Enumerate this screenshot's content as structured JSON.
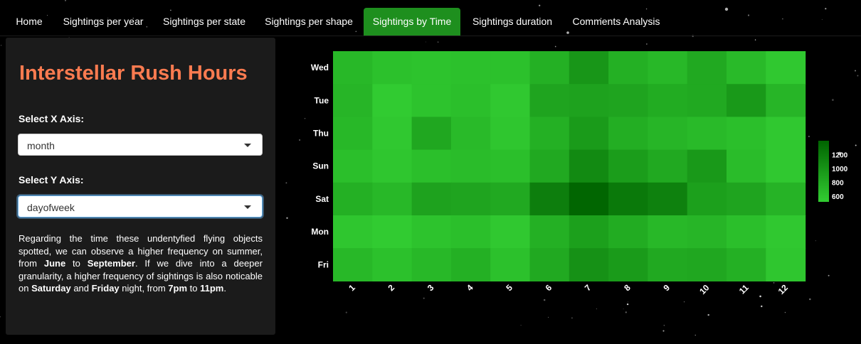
{
  "nav": {
    "items": [
      {
        "label": "Home",
        "active": false
      },
      {
        "label": "Sightings per year",
        "active": false
      },
      {
        "label": "Sightings per state",
        "active": false
      },
      {
        "label": "Sightings per shape",
        "active": false
      },
      {
        "label": "Sightings by Time",
        "active": true
      },
      {
        "label": "Sightings duration",
        "active": false
      },
      {
        "label": "Comments Analysis",
        "active": false
      }
    ]
  },
  "sidebar": {
    "title": "Interstellar Rush Hours",
    "x_axis": {
      "label": "Select X Axis:",
      "value": "month"
    },
    "y_axis": {
      "label": "Select Y Axis:",
      "value": "dayofweek"
    },
    "description": [
      {
        "text": "Regarding the time these undentyfied flying objects spotted, we can observe a higher frequency on summer, from ",
        "bold": false
      },
      {
        "text": "June",
        "bold": true
      },
      {
        "text": " to ",
        "bold": false
      },
      {
        "text": "September",
        "bold": true
      },
      {
        "text": ". If we dive into a deeper granularity, a higher frequency of sightings is also noticable on ",
        "bold": false
      },
      {
        "text": "Saturday",
        "bold": true
      },
      {
        "text": " and ",
        "bold": false
      },
      {
        "text": "Friday",
        "bold": true
      },
      {
        "text": " night, from ",
        "bold": false
      },
      {
        "text": "7pm",
        "bold": true
      },
      {
        "text": " to ",
        "bold": false
      },
      {
        "text": "11pm",
        "bold": true
      },
      {
        "text": ".",
        "bold": false
      }
    ]
  },
  "colors": {
    "accent": "#1e8f1e",
    "title": "#fb7b50",
    "scale_low": "#32cd32",
    "scale_high": "#006400"
  },
  "chart_data": {
    "type": "heatmap",
    "x": [
      "1",
      "2",
      "3",
      "4",
      "5",
      "6",
      "7",
      "8",
      "9",
      "10",
      "11",
      "12"
    ],
    "y": [
      "Wed",
      "Tue",
      "Thu",
      "Sun",
      "Sat",
      "Mon",
      "Fri"
    ],
    "z": [
      [
        700,
        620,
        600,
        620,
        620,
        760,
        980,
        760,
        700,
        820,
        680,
        560
      ],
      [
        720,
        540,
        600,
        640,
        560,
        860,
        880,
        860,
        800,
        820,
        960,
        720
      ],
      [
        700,
        560,
        840,
        680,
        580,
        760,
        940,
        780,
        720,
        680,
        640,
        560
      ],
      [
        640,
        580,
        640,
        660,
        640,
        820,
        1080,
        920,
        820,
        960,
        660,
        560
      ],
      [
        760,
        700,
        880,
        860,
        820,
        1180,
        1380,
        1220,
        1160,
        900,
        860,
        740
      ],
      [
        580,
        540,
        600,
        640,
        560,
        760,
        900,
        800,
        700,
        720,
        640,
        560
      ],
      [
        700,
        620,
        700,
        760,
        620,
        820,
        1020,
        940,
        820,
        840,
        760,
        580
      ]
    ],
    "colorbar_ticks": [
      1200,
      1000,
      800,
      600
    ],
    "zmin": 520,
    "zmax": 1400
  }
}
